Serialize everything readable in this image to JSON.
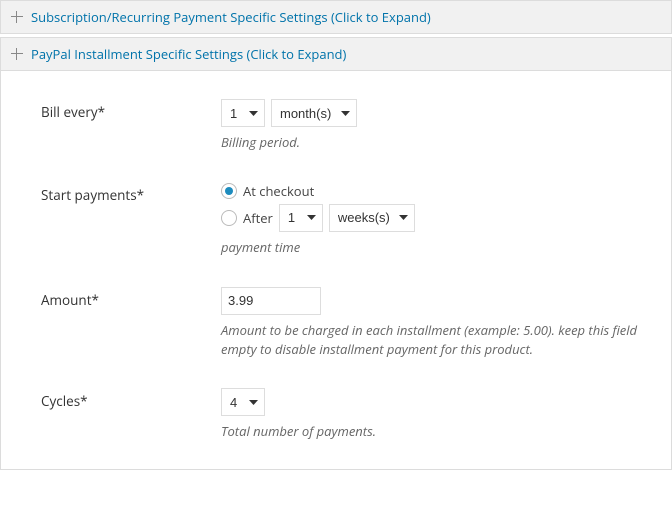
{
  "accordion_sub": {
    "title": "Subscription/Recurring Payment Specific Settings (Click to Expand)"
  },
  "accordion_inst": {
    "title": "PayPal Installment Specific Settings (Click to Expand)"
  },
  "bill_every": {
    "label": "Bill every*",
    "value_num": "1",
    "value_unit": "month(s)",
    "help": "Billing period."
  },
  "start_payments": {
    "label": "Start payments*",
    "opt_checkout": "At checkout",
    "opt_after": "After",
    "after_num": "1",
    "after_unit": "weeks(s)",
    "help": "payment time"
  },
  "amount": {
    "label": "Amount*",
    "value": "3.99",
    "help": "Amount to be charged in each installment (example: 5.00). keep this field empty to disable installment payment for this product."
  },
  "cycles": {
    "label": "Cycles*",
    "value": "4",
    "help": "Total number of payments."
  }
}
